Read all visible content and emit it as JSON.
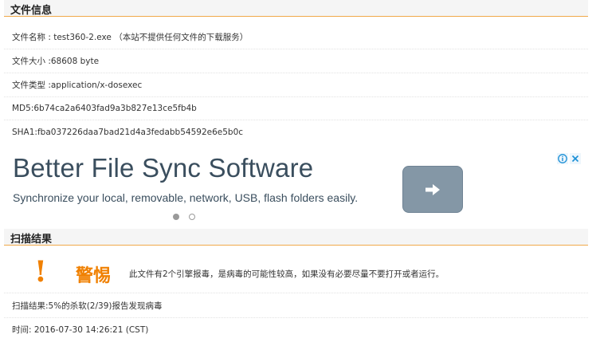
{
  "file_info": {
    "header": "文件信息",
    "rows": [
      "文件名称 : test360-2.exe （本站不提供任何文件的下载服务）",
      "文件大小 :68608 byte",
      "文件类型 :application/x-dosexec",
      "MD5:6b74ca2a6403fad9a3b827e13ce5fb4b",
      "SHA1:fba037226daa7bad21d4a3fedabb54592e6e5b0c"
    ]
  },
  "ad": {
    "title": "Better File Sync Software",
    "subtitle": "Synchronize your local, removable, network, USB, flash folders easily.",
    "button_icon": "arrow-right-icon",
    "choices_icons": [
      "info-icon",
      "close-icon"
    ],
    "carousel_active_index": 0,
    "carousel_count": 2
  },
  "scan": {
    "header": "扫描结果",
    "warning_title": "警惕",
    "warning_message": "此文件有2个引擎报毒，是病毒的可能性较高，如果没有必要尽量不要打开或者运行。",
    "result": "扫描结果:5%的杀软(2/39)报告发现病毒",
    "time": "时间: 2016-07-30 14:26:21 (CST)"
  },
  "colors": {
    "accent": "#f08000",
    "header_border": "#f0a94a",
    "ad_button": "#8497a6",
    "ad_text": "#3a4e5e"
  }
}
